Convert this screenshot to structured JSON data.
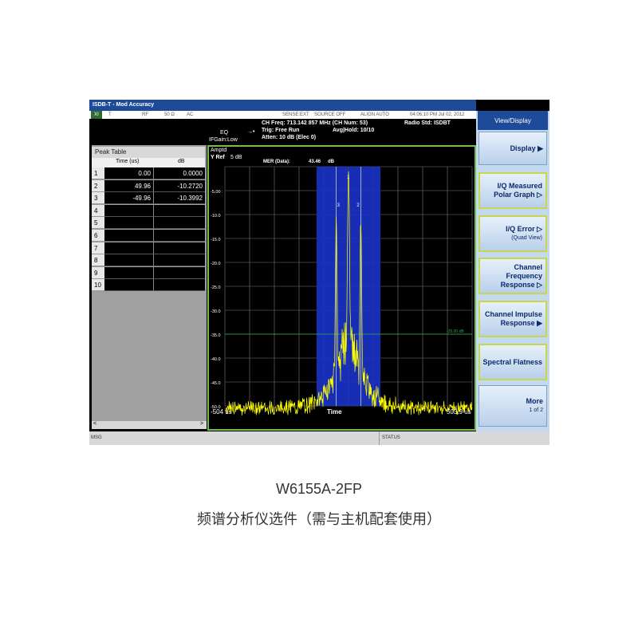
{
  "window": {
    "title": "ISDB-T - Mod Accuracy",
    "status_cells": [
      "T",
      "RF",
      "50 Ω",
      "AC",
      "SENSE:EXT",
      "SOURCE OFF",
      "ALIGN AUTO"
    ],
    "datetime": "04:06:10 PM Jul 02, 2012"
  },
  "info": {
    "ch_freq": "CH Freq: 713.142 857 MHz (CH Num: 53)",
    "radio_std": "Radio Std: ISDBT",
    "trig": "Trig: Free Run",
    "avg_hold": "Avg|Hold: 10/10",
    "atten": "Atten: 10 dB (Elec 0)",
    "eq": "EQ",
    "ifgain": "IFGain:Low"
  },
  "menu": {
    "title": "View/Display",
    "keys": [
      {
        "label": "Display",
        "sub": "",
        "arrow": "▶"
      },
      {
        "label": "I/Q Measured Polar Graph",
        "sub": "",
        "arrow": "▷"
      },
      {
        "label": "I/Q Error",
        "sub": "(Quad View)",
        "arrow": "▷"
      },
      {
        "label": "Channel Frequency Response",
        "sub": "",
        "arrow": "▷"
      },
      {
        "label": "Channel Impulse Response",
        "sub": "",
        "arrow": "▶"
      },
      {
        "label": "Spectral Flatness",
        "sub": "",
        "arrow": ""
      },
      {
        "label": "More",
        "sub": "1 of 2",
        "arrow": ""
      }
    ]
  },
  "peak_table": {
    "title": "Peak Table",
    "columns": [
      "Time (us)",
      "dB"
    ],
    "rows": [
      {
        "n": "1",
        "time": "0.00",
        "db": "0.0000"
      },
      {
        "n": "2",
        "time": "49.96",
        "db": "-10.2720"
      },
      {
        "n": "3",
        "time": "-49.96",
        "db": "-10.3992"
      },
      {
        "n": "4",
        "time": "",
        "db": ""
      },
      {
        "n": "5",
        "time": "",
        "db": ""
      },
      {
        "n": "6",
        "time": "",
        "db": ""
      },
      {
        "n": "7",
        "time": "",
        "db": ""
      },
      {
        "n": "8",
        "time": "",
        "db": ""
      },
      {
        "n": "9",
        "time": "",
        "db": ""
      },
      {
        "n": "10",
        "time": "",
        "db": ""
      }
    ]
  },
  "graph": {
    "ampl_label": "Amptd",
    "yref_label": "Y Ref",
    "yscale": "5 dB",
    "mer_label": "MER (Data):",
    "mer_value": "43.46",
    "mer_unit": "dB",
    "x_start": "-504 us",
    "x_stop": "503.9 us",
    "x_label": "Time",
    "threshold_label": "-35.00 dB",
    "y_ticks": [
      "-5.00",
      "-10.0",
      "-15.0",
      "-20.0",
      "-25.0",
      "-30.0",
      "-35.0",
      "-40.0",
      "-45.0",
      "-50.0"
    ],
    "marker_labels": [
      "1",
      "2",
      "3"
    ],
    "trace_color": "#ffff00",
    "band_color": "#1a33c8",
    "grid_color": "#777777",
    "threshold_color": "#2fa84a"
  },
  "bottom": {
    "msg": "MSG",
    "status": "STATUS"
  },
  "caption": {
    "model": "W6155A-2FP",
    "desc": "频谱分析仪选件（需与主机配套使用）"
  }
}
